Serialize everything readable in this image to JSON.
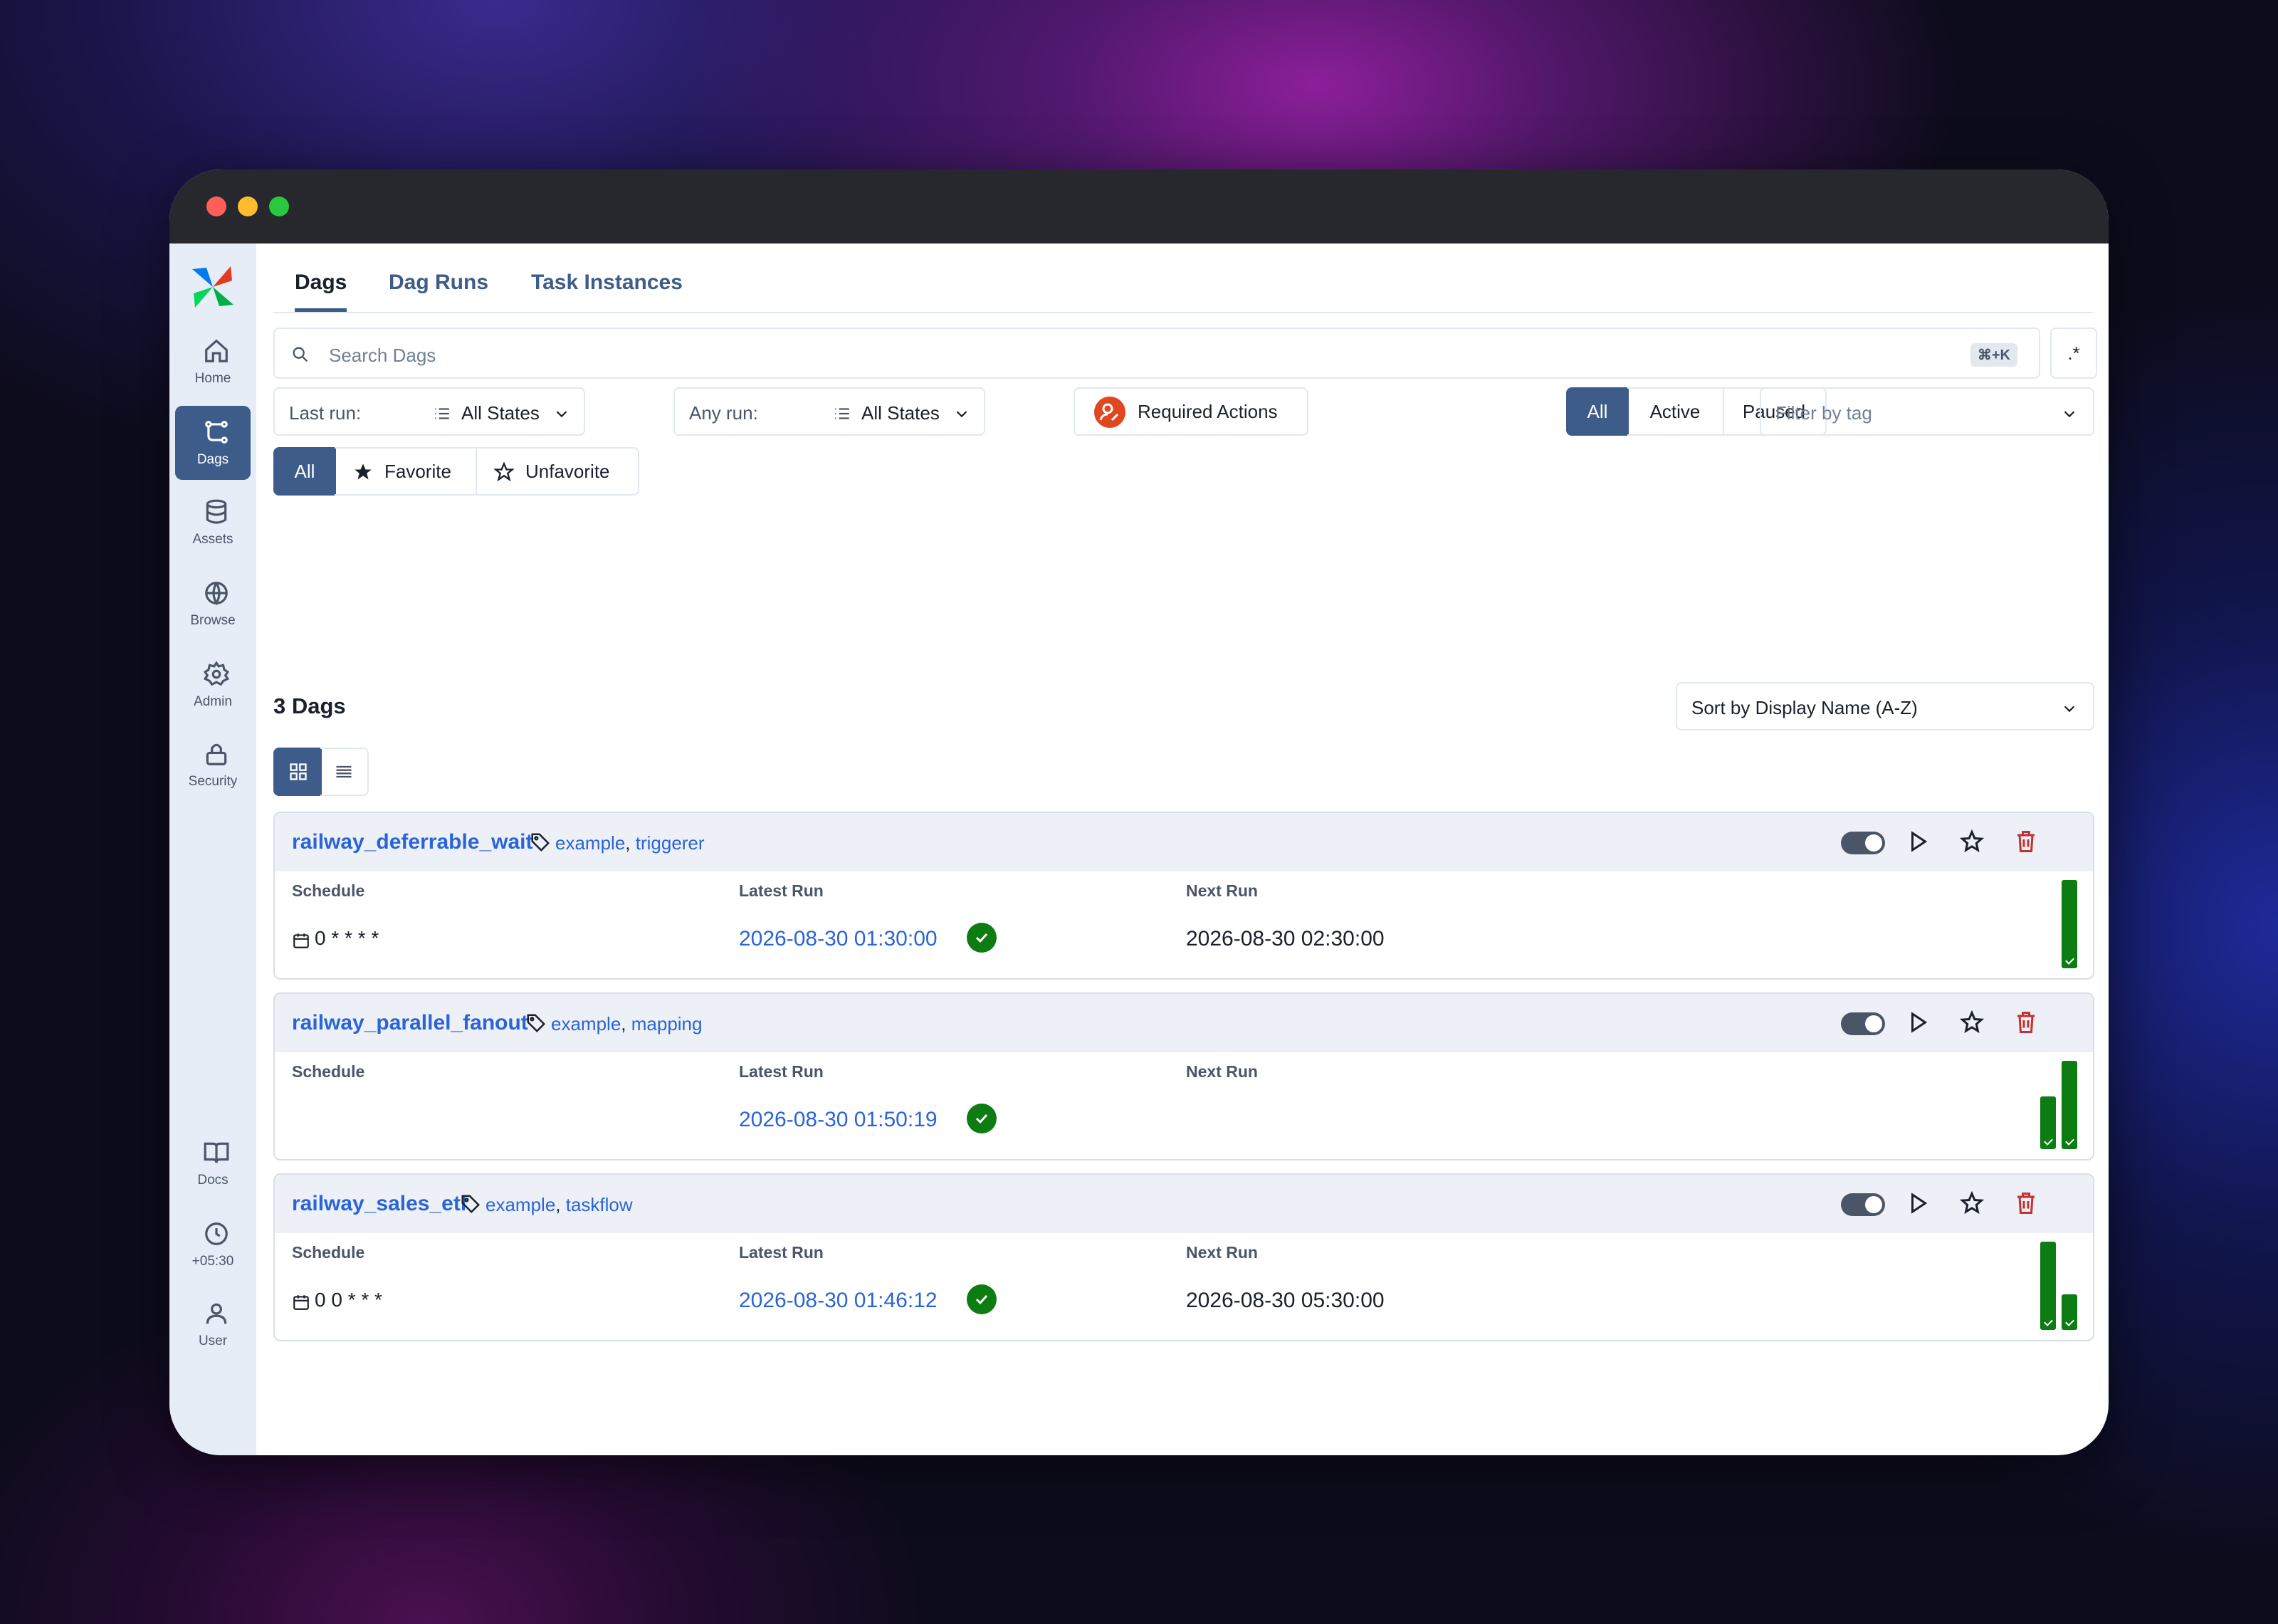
{
  "window": {
    "buttons": [
      "close",
      "minimize",
      "maximize"
    ],
    "colors": {
      "close": "#ff5f57",
      "minimize": "#febc2e",
      "maximize": "#28c840"
    }
  },
  "sidebar": {
    "logo": "airflow-logo",
    "items": [
      {
        "label": "Home",
        "icon": "home-icon"
      },
      {
        "label": "Dags",
        "icon": "dags-icon",
        "active": true
      },
      {
        "label": "Assets",
        "icon": "database-icon"
      },
      {
        "label": "Browse",
        "icon": "globe-icon"
      },
      {
        "label": "Admin",
        "icon": "gear-icon"
      },
      {
        "label": "Security",
        "icon": "lock-icon"
      }
    ],
    "bottom_items": [
      {
        "label": "Docs",
        "icon": "book-icon"
      },
      {
        "label": "+05:30",
        "icon": "clock-icon"
      },
      {
        "label": "User",
        "icon": "user-icon"
      }
    ]
  },
  "tabs": [
    {
      "label": "Dags",
      "active": true
    },
    {
      "label": "Dag Runs"
    },
    {
      "label": "Task Instances"
    }
  ],
  "search": {
    "placeholder": "Search Dags",
    "shortcut": "⌘+K",
    "regex_icon": ".*"
  },
  "filters": {
    "last_run": {
      "label": "Last run:",
      "value": "All States"
    },
    "any_run": {
      "label": "Any run:",
      "value": "All States"
    },
    "required_actions": "Required Actions",
    "state_buttons": [
      {
        "label": "All",
        "selected": true
      },
      {
        "label": "Active"
      },
      {
        "label": "Paused"
      }
    ],
    "tag_placeholder": "Filter by tag",
    "favorite_buttons": [
      {
        "label": "All",
        "selected": true
      },
      {
        "label": "Favorite"
      },
      {
        "label": "Unfavorite"
      }
    ]
  },
  "list": {
    "count": "3 Dags",
    "sort": "Sort by Display Name (A-Z)",
    "view_modes": [
      "grid-view-icon",
      "list-view-icon"
    ],
    "column_headers": {
      "schedule": "Schedule",
      "latest_run": "Latest Run",
      "next_run": "Next Run"
    }
  },
  "dags": [
    {
      "name": "railway_deferrable_wait",
      "tags": [
        "example",
        "triggerer"
      ],
      "schedule": "0 * * * *",
      "latest_run": "2026-08-30 01:30:00",
      "latest_state": "success",
      "next_run": "2026-08-30 02:30:00",
      "recent_run_durations": [
        1.0
      ]
    },
    {
      "name": "railway_parallel_fanout",
      "tags": [
        "example",
        "mapping"
      ],
      "schedule": "",
      "latest_run": "2026-08-30 01:50:19",
      "latest_state": "success",
      "next_run": "",
      "recent_run_durations": [
        0.6,
        1.0
      ]
    },
    {
      "name": "railway_sales_etl",
      "tags": [
        "example",
        "taskflow"
      ],
      "schedule": "0 0 * * *",
      "latest_run": "2026-08-30 01:46:12",
      "latest_state": "success",
      "next_run": "2026-08-30 05:30:00",
      "recent_run_durations": [
        1.0,
        0.4
      ]
    }
  ],
  "colors": {
    "accent": "#3e5c89",
    "link": "#2a64d8",
    "success": "#0c7c13",
    "danger": "#c53030",
    "required_actions": "#e0461f"
  }
}
